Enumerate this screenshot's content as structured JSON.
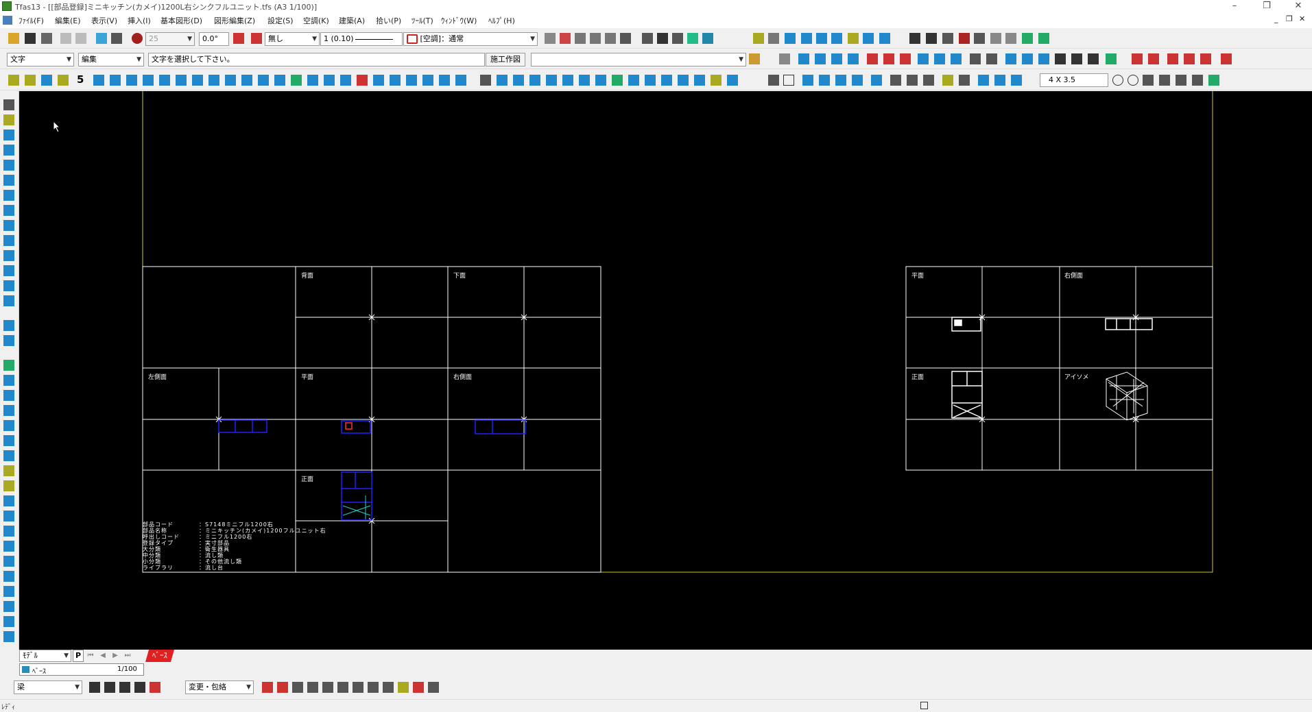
{
  "window": {
    "title": "Tfas13 - [[部品登録]ミニキッチン(カメイ)1200L右シンクフルユニット.tfs (A3 1/100)]",
    "controls": [
      "–",
      "❐",
      "✕"
    ],
    "child_controls": [
      "_",
      "❐",
      "✕"
    ]
  },
  "menu": [
    "ﾌｧｲﾙ(F)",
    "編集(E)",
    "表示(V)",
    "挿入(I)",
    "基本図形(D)",
    "図形編集(Z)",
    "設定(S)",
    "空調(K)",
    "建築(A)",
    "拾い(P)",
    "ﾂｰﾙ(T)",
    "ｳｨﾝﾄﾞｳ(W)",
    "ﾍﾙﾌﾟ(H)"
  ],
  "toolbar1": {
    "width_value": "25",
    "angle_value": "0.0°",
    "linetype_value": "無し",
    "scale_value": "1 (0.10)",
    "mode_value": "[空調]：通常"
  },
  "toolbar2": {
    "mode_select": "文字",
    "action_select": "編集",
    "prompt": "文字を選択して下さい。",
    "button_label": "施工作図",
    "search_value": ""
  },
  "toolbar3": {
    "number_label": "5",
    "grid_size": "4 X 3.5"
  },
  "drawing": {
    "left_sheet_labels": {
      "back": "背面",
      "bottom": "下面",
      "left": "左側面",
      "plan": "平面",
      "right": "右側面",
      "front": "正面"
    },
    "right_sheet_labels": {
      "plan": "平面",
      "right": "右側面",
      "front": "正面",
      "iso": "アイソメ"
    },
    "part_info": [
      {
        "key": "部品コード",
        "value": "：S7148ミニフル1200右"
      },
      {
        "key": "部品名称",
        "value": "：ミニキッチン(カメイ)1200フルユニット右"
      },
      {
        "key": "呼出しコード",
        "value": "：ミニフル1200右"
      },
      {
        "key": "登録タイプ",
        "value": "：実寸部品"
      },
      {
        "key": "大分類",
        "value": "：衛生器具"
      },
      {
        "key": "中分類",
        "value": "：流し類"
      },
      {
        "key": "小分類",
        "value": "：その他流し類"
      },
      {
        "key": "ライブラリ",
        "value": "：流し台"
      }
    ],
    "colors": {
      "frame": "#c8c832",
      "grid": "#ffffff",
      "part": "#2020ff"
    }
  },
  "tabs": {
    "view_select": "ﾓﾃﾞﾙ",
    "p_button": "P",
    "active_tab": "ﾍﾞｰｽ"
  },
  "layer_bar": {
    "layer_name": "ﾍﾞｰｽ",
    "scale": "1/100"
  },
  "bottom_toolbar": {
    "element_select": "梁",
    "change_select": "変更・包絡"
  },
  "status": {
    "text": "ﾚﾃﾞｨ"
  }
}
